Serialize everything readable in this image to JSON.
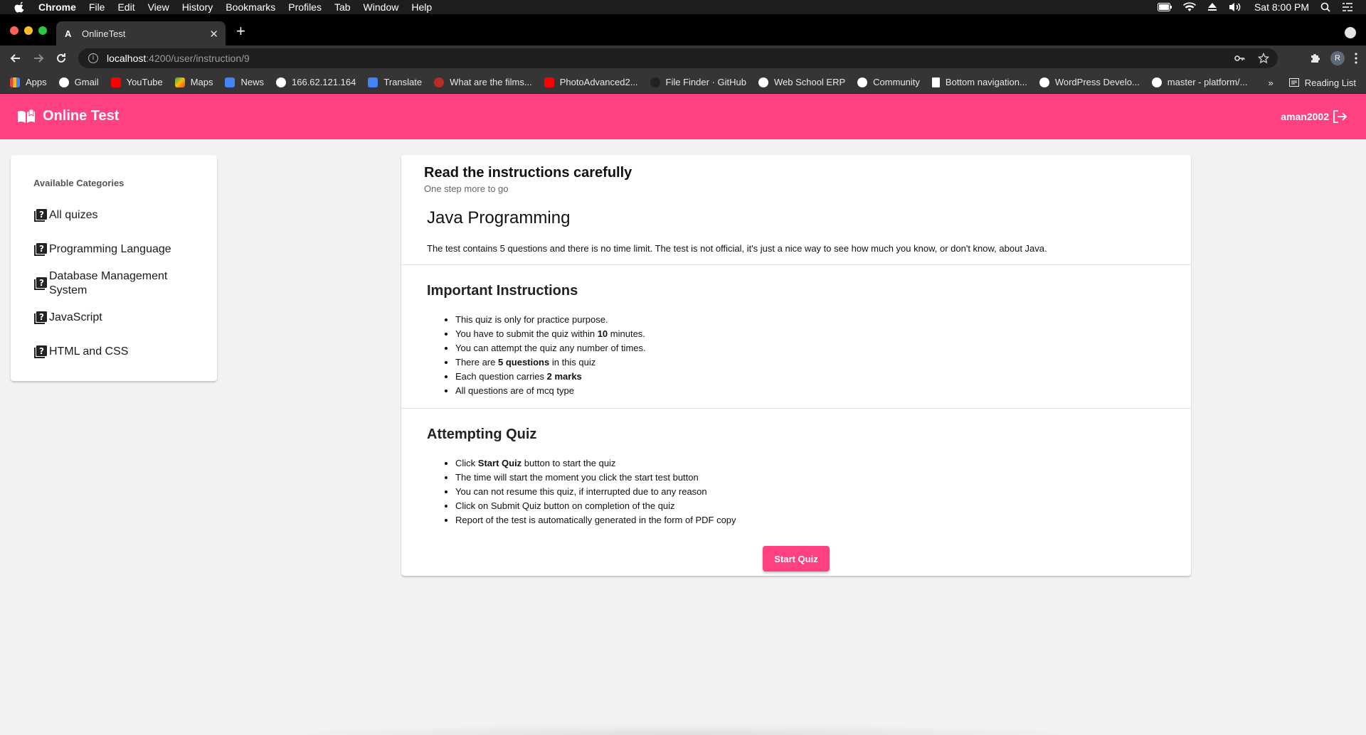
{
  "mac_menubar": {
    "items": [
      "Chrome",
      "File",
      "Edit",
      "View",
      "History",
      "Bookmarks",
      "Profiles",
      "Tab",
      "Window",
      "Help"
    ],
    "clock": "Sat 8:00 PM"
  },
  "browser": {
    "tab_title": "OnlineTest",
    "tab_favicon": "A",
    "url_host": "localhost",
    "url_path": ":4200/user/instruction/9",
    "avatar_letter": "R",
    "bookmarks": [
      {
        "label": "Apps",
        "icon": "apps-grid-icon",
        "color": "#e8453c"
      },
      {
        "label": "Gmail",
        "icon": "google-icon",
        "color": "#ffffff"
      },
      {
        "label": "YouTube",
        "icon": "youtube-icon",
        "color": "#ff0000"
      },
      {
        "label": "Maps",
        "icon": "maps-icon",
        "color": "#34a853"
      },
      {
        "label": "News",
        "icon": "news-icon",
        "color": "#4285f4"
      },
      {
        "label": "166.62.121.164",
        "icon": "globe-icon",
        "color": "#ffffff"
      },
      {
        "label": "Translate",
        "icon": "translate-icon",
        "color": "#4285f4"
      },
      {
        "label": "What are the films...",
        "icon": "quora-icon",
        "color": "#b92b27"
      },
      {
        "label": "PhotoAdvanced2...",
        "icon": "youtube-icon",
        "color": "#ff0000"
      },
      {
        "label": "File Finder · GitHub",
        "icon": "github-icon",
        "color": "#222222"
      },
      {
        "label": "Web School ERP",
        "icon": "globe-icon",
        "color": "#ffffff"
      },
      {
        "label": "Community",
        "icon": "globe-icon",
        "color": "#ffffff"
      },
      {
        "label": "Bottom navigation...",
        "icon": "page-icon",
        "color": "#ffffff"
      },
      {
        "label": "WordPress Develo...",
        "icon": "wordpress-icon",
        "color": "#ffffff"
      },
      {
        "label": "master - platform/...",
        "icon": "globe-icon",
        "color": "#ffffff"
      }
    ],
    "overflow_label": "»",
    "reading_list": "Reading List"
  },
  "app": {
    "title": "Online Test",
    "username": "aman2002",
    "accent": "#ff4081"
  },
  "sidebar": {
    "heading": "Available Categories",
    "items": [
      {
        "label": "All quizes"
      },
      {
        "label": "Programming Language"
      },
      {
        "label": "Database Management System"
      },
      {
        "label": "JavaScript"
      },
      {
        "label": "HTML and CSS"
      }
    ]
  },
  "main": {
    "title": "Read the instructions carefully",
    "subtitle": "One step more to go",
    "quiz_title": "Java Programming",
    "quiz_description": "The test contains 5 questions and there is no time limit. The test is not official, it's just a nice way to see how much you know, or don't know, about Java.",
    "important_heading": "Important Instructions",
    "important": {
      "i1": "This quiz is only for practice purpose.",
      "i2_pre": "You have to submit the quiz within ",
      "i2_bold": "10",
      "i2_post": " minutes.",
      "i3": "You can attempt the quiz any number of times.",
      "i4_pre": "There are ",
      "i4_bold": "5 questions",
      "i4_post": " in this quiz",
      "i5_pre": "Each question carries ",
      "i5_bold": "2 marks",
      "i6": "All questions are of mcq type"
    },
    "attempting_heading": "Attempting Quiz",
    "attempting": {
      "a1_pre": "Click ",
      "a1_bold": "Start Quiz",
      "a1_post": " button to start the quiz",
      "a2": "The time will start the moment you click the start test button",
      "a3": "You can not resume this quiz, if interrupted due to any reason",
      "a4": "Click on Submit Quiz button on completion of the quiz",
      "a5": "Report of the test is automatically generated in the form of PDF copy"
    },
    "start_button": "Start Quiz"
  }
}
